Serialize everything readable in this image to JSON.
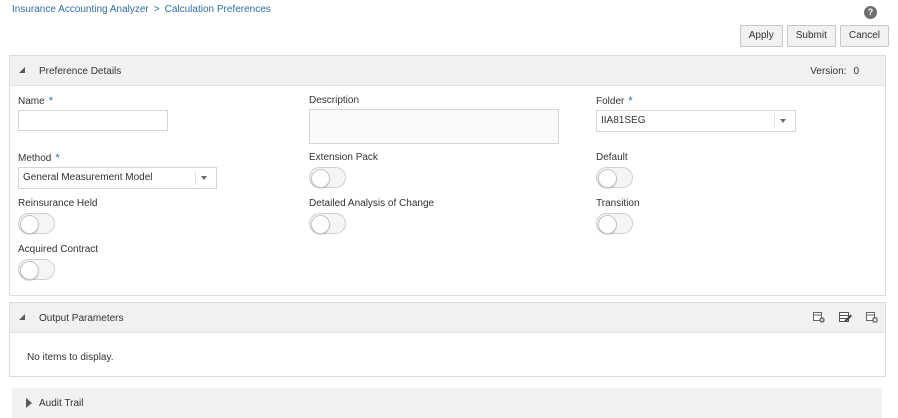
{
  "breadcrumb": {
    "parent": "Insurance Accounting Analyzer",
    "separator": ">",
    "current": "Calculation Preferences"
  },
  "help_icon": "help-icon",
  "toolbar": {
    "apply_label": "Apply",
    "submit_label": "Submit",
    "cancel_label": "Cancel"
  },
  "preference_details": {
    "title": "Preference Details",
    "version_label": "Version:",
    "version_value": "0",
    "required_marker": "*",
    "fields": {
      "name_label": "Name",
      "name_value": "",
      "description_label": "Description",
      "description_value": "",
      "folder_label": "Folder",
      "folder_value": "IIA81SEG",
      "method_label": "Method",
      "method_value": "General Measurement Model",
      "extension_pack_label": "Extension Pack",
      "default_label": "Default",
      "reinsurance_held_label": "Reinsurance Held",
      "detailed_analysis_label": "Detailed Analysis of Change",
      "transition_label": "Transition",
      "acquired_contract_label": "Acquired Contract"
    },
    "toggles": {
      "extension_pack": false,
      "default": false,
      "reinsurance_held": false,
      "detailed_analysis_of_change": false,
      "transition": false,
      "acquired_contract": false
    }
  },
  "output_parameters": {
    "title": "Output Parameters",
    "empty_text": "No items to display.",
    "icons": [
      "add-row-icon",
      "edit-row-icon",
      "delete-row-icon"
    ]
  },
  "audit_trail": {
    "title": "Audit Trail"
  },
  "colors": {
    "link": "#2f6ea8",
    "panel_header": "#f1f1f1",
    "border": "#dcdcdc"
  }
}
